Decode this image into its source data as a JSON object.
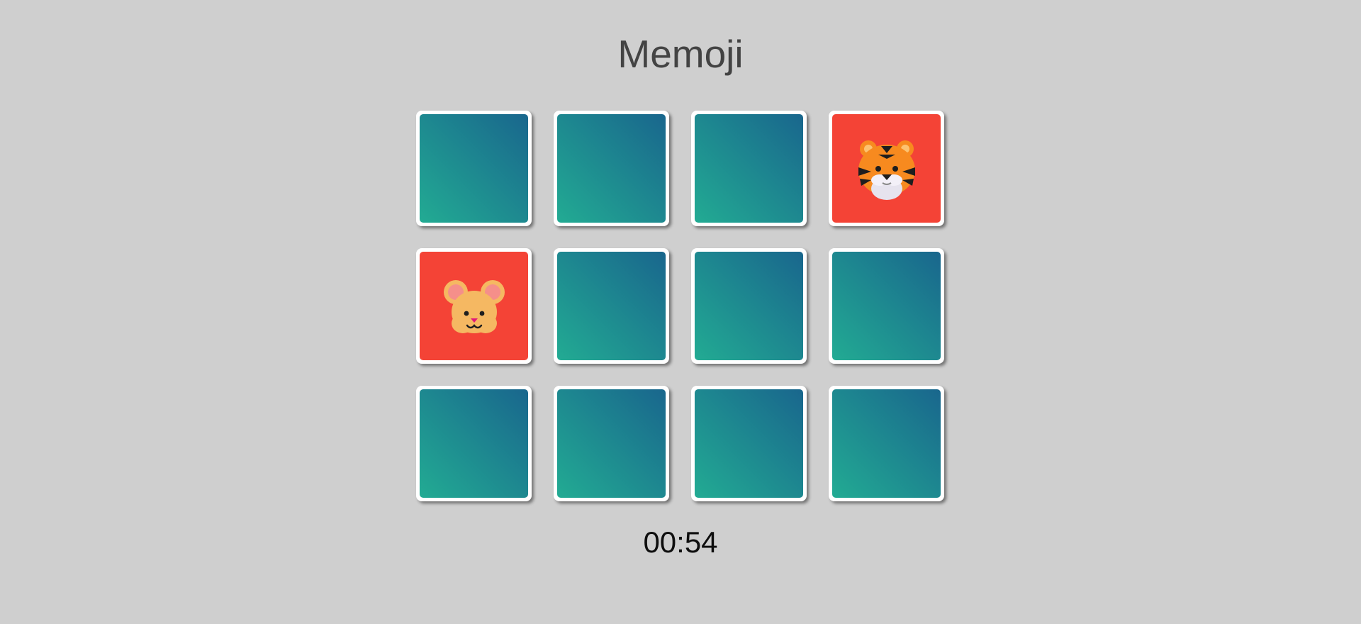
{
  "game": {
    "title": "Memoji",
    "timer": "00:54",
    "colors": {
      "background": "#cfcfcf",
      "card_back_gradient_start": "#22ab93",
      "card_back_gradient_end": "#19668d",
      "open_card_background": "#f44336",
      "card_border": "#ffffff"
    }
  },
  "cards": [
    {
      "state": "closed",
      "emoji": ""
    },
    {
      "state": "closed",
      "emoji": ""
    },
    {
      "state": "closed",
      "emoji": ""
    },
    {
      "state": "open",
      "emoji": "tiger-face-icon"
    },
    {
      "state": "open",
      "emoji": "mouse-face-icon"
    },
    {
      "state": "closed",
      "emoji": ""
    },
    {
      "state": "closed",
      "emoji": ""
    },
    {
      "state": "closed",
      "emoji": ""
    },
    {
      "state": "closed",
      "emoji": ""
    },
    {
      "state": "closed",
      "emoji": ""
    },
    {
      "state": "closed",
      "emoji": ""
    },
    {
      "state": "closed",
      "emoji": ""
    }
  ]
}
